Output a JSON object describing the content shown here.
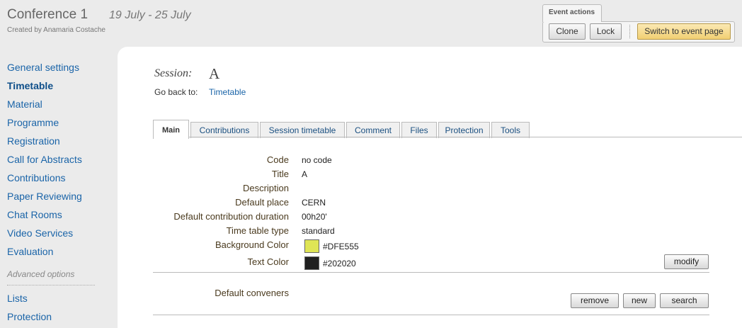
{
  "header": {
    "title": "Conference 1",
    "dates": "19 July - 25 July",
    "created_by": "Created by Anamaria Costache"
  },
  "event_actions": {
    "label": "Event actions",
    "clone": "Clone",
    "lock": "Lock",
    "switch": "Switch to event page"
  },
  "sidebar": {
    "items": [
      {
        "label": "General settings"
      },
      {
        "label": "Timetable"
      },
      {
        "label": "Material"
      },
      {
        "label": "Programme"
      },
      {
        "label": "Registration"
      },
      {
        "label": "Call for Abstracts"
      },
      {
        "label": "Contributions"
      },
      {
        "label": "Paper Reviewing"
      },
      {
        "label": "Chat Rooms"
      },
      {
        "label": "Video Services"
      },
      {
        "label": "Evaluation"
      }
    ],
    "advanced_label": "Advanced options",
    "advanced_items": [
      {
        "label": "Lists"
      },
      {
        "label": "Protection"
      }
    ]
  },
  "session": {
    "label": "Session:",
    "name": "A",
    "go_back_label": "Go back to:",
    "go_back_link": "Timetable"
  },
  "tabs": [
    {
      "label": "Main"
    },
    {
      "label": "Contributions"
    },
    {
      "label": "Session timetable"
    },
    {
      "label": "Comment"
    },
    {
      "label": "Files"
    },
    {
      "label": "Protection"
    },
    {
      "label": "Tools"
    }
  ],
  "fields": {
    "code": {
      "label": "Code",
      "value": "no code"
    },
    "title": {
      "label": "Title",
      "value": "A"
    },
    "description": {
      "label": "Description",
      "value": ""
    },
    "default_place": {
      "label": "Default place",
      "value": "CERN"
    },
    "duration": {
      "label": "Default contribution duration",
      "value": "00h20'"
    },
    "tt_type": {
      "label": "Time table type",
      "value": "standard"
    },
    "bg_color": {
      "label": "Background Color",
      "value": "#DFE555"
    },
    "text_color": {
      "label": "Text Color",
      "value": "#202020"
    }
  },
  "modify_label": "modify",
  "conveners": {
    "label": "Default conveners",
    "remove": "remove",
    "new": "new",
    "search": "search"
  }
}
